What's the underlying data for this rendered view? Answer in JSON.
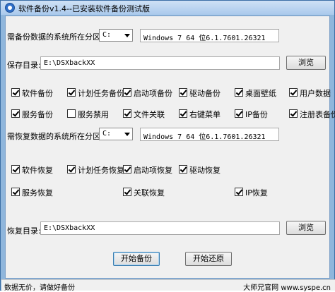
{
  "window": {
    "title": "软件备份v1.4--已安装软件备份测试版"
  },
  "backup": {
    "partition_label": "需备份数据的系统所在分区:",
    "partition_value": "C:",
    "os_info": "Windows 7 64 位6.1.7601.26321",
    "save_label": "保存目录:",
    "save_path": "E:\\DSXbackXX",
    "browse_label": "浏览",
    "options": [
      {
        "label": "软件备份",
        "checked": true
      },
      {
        "label": "计划任务备份",
        "checked": true
      },
      {
        "label": "启动项备份",
        "checked": true
      },
      {
        "label": "驱动备份",
        "checked": true
      },
      {
        "label": "桌面壁纸",
        "checked": true
      },
      {
        "label": "用户数据",
        "checked": true
      },
      {
        "label": "服务备份",
        "checked": true
      },
      {
        "label": "服务禁用",
        "checked": false
      },
      {
        "label": "文件关联",
        "checked": true
      },
      {
        "label": "右键菜单",
        "checked": true
      },
      {
        "label": "IP备份",
        "checked": true
      },
      {
        "label": "注册表备份",
        "checked": true
      }
    ]
  },
  "restore": {
    "partition_label": "需恢复数据的系统所在分区:",
    "partition_value": "C:",
    "os_info": "Windows 7 64 位6.1.7601.26321",
    "options": [
      {
        "label": "软件恢复",
        "checked": true
      },
      {
        "label": "计划任务恢复",
        "checked": true
      },
      {
        "label": "启动项恢复",
        "checked": true
      },
      {
        "label": "驱动恢复",
        "checked": true
      },
      {
        "label": "服务恢复",
        "checked": true
      },
      {
        "label": "关联恢复",
        "checked": true
      },
      {
        "label": "IP恢复",
        "checked": true
      }
    ],
    "dir_label": "恢复目录:",
    "dir_path": "E:\\DSXbackXX",
    "browse_label": "浏览"
  },
  "actions": {
    "start_backup": "开始备份",
    "start_restore": "开始还原"
  },
  "status": {
    "left": "数据无价，请做好备份",
    "right": "大师兄官网 www.syspe.cn"
  }
}
